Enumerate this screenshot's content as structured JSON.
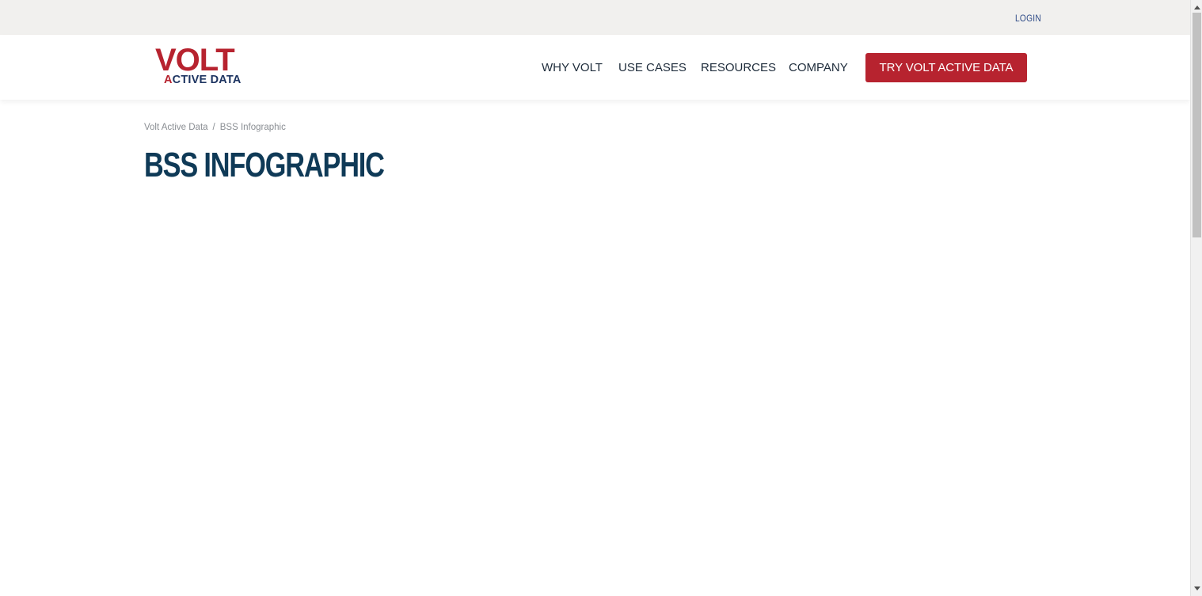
{
  "util_bar": {
    "login_label": "LOGIN"
  },
  "logo": {
    "top_text": "VOLT",
    "bottom_accent": "A",
    "bottom_rest": "CTIVE DATA"
  },
  "nav": {
    "items": [
      {
        "label": "WHY VOLT"
      },
      {
        "label": "USE CASES"
      },
      {
        "label": "RESOURCES"
      },
      {
        "label": "COMPANY"
      }
    ],
    "cta_label": "TRY VOLT ACTIVE DATA"
  },
  "breadcrumb": {
    "home": "Volt Active Data",
    "separator": "/",
    "current": "BSS Infographic"
  },
  "page": {
    "title": "BSS INFOGRAPHIC"
  },
  "colors": {
    "brand_red": "#b7232f",
    "brand_navy": "#1d3461",
    "title_color": "#0f3a57",
    "util_bar_bg": "#f1f0ee"
  }
}
